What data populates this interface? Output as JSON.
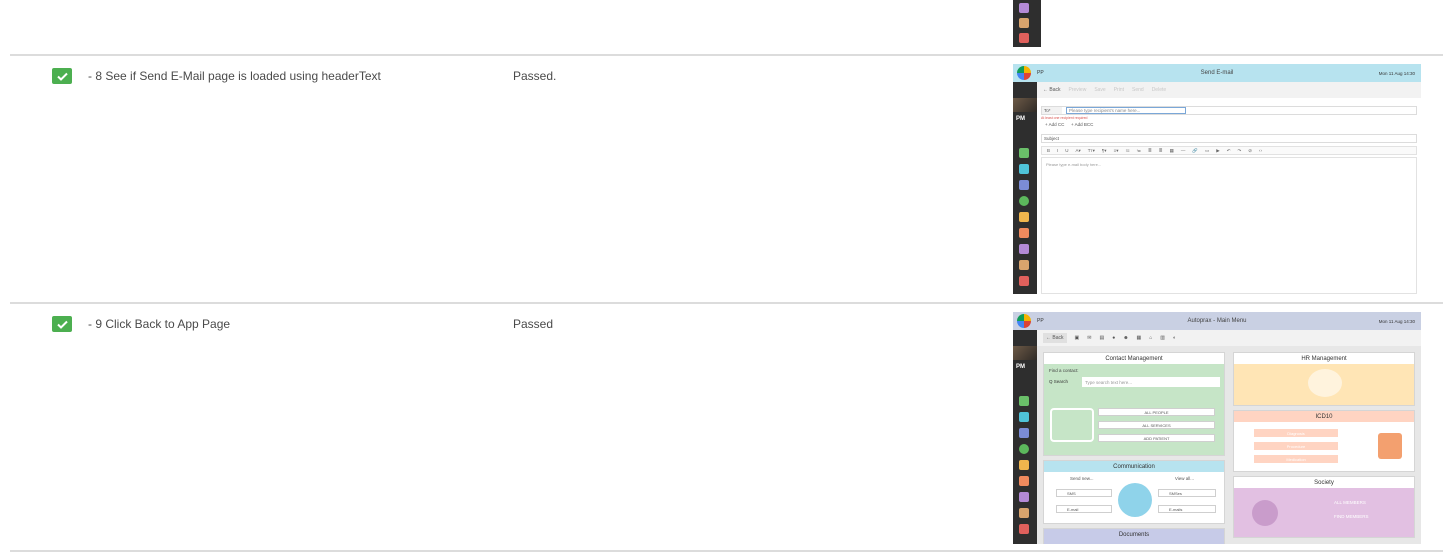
{
  "rows": [
    {
      "status": "passed",
      "step": "- 8 See if Send E-Mail page is loaded using headerText",
      "result": "Passed.",
      "screenshot": {
        "app_name": "PP",
        "page_title": "Send E-mail",
        "clock": "Mon 11 Aug 14:30",
        "toolbar": [
          "← Back",
          "Preview",
          "Save",
          "Print",
          "Send",
          "Delete"
        ],
        "to_label": "To*",
        "to_placeholder": "Please type recipient's name here...",
        "to_error": "At least one recipient required",
        "add_cc": "+ Add CC",
        "add_bcc": "+ Add BCC",
        "subject_label": "Subject",
        "editor_placeholder": "Please type e-mail body here...",
        "editor_toolbar": [
          "B",
          "I",
          "U",
          "A▾",
          "Tт▾",
          "¶▾",
          "≡▾",
          "⁝≡",
          "≔",
          "≣",
          "≣",
          "▦",
          "—",
          "🔗",
          "▭",
          "▶",
          "↶",
          "↷",
          "⊘",
          "‹›"
        ],
        "sidebar_initials": "PM"
      }
    },
    {
      "status": "passed",
      "step": "- 9 Click Back to App Page",
      "result": "Passed",
      "screenshot": {
        "app_name": "PP",
        "page_title": "Autoprax - Main Menu",
        "clock": "Mon 11 Aug 14:30",
        "back": "← Back",
        "contact_title": "Contact Management",
        "find_contact": "Find a contact:",
        "search_btn": "Q Search",
        "search_placeholder": "Type search text here...",
        "contact_buttons": [
          "ALL PEOPLE",
          "ALL SERVICES",
          "ADD PATIENT"
        ],
        "communication_title": "Communication",
        "send_new": "Send new...",
        "view_all": "View all...",
        "comm_left": [
          "SMS",
          "E-mail"
        ],
        "comm_right": [
          "SMSes",
          "E-mails"
        ],
        "documents_title": "Documents",
        "hr_title": "HR Management",
        "icd_title": "ICD10",
        "icd_buttons": [
          "Diagnosis",
          "Procedure",
          "Medication"
        ],
        "society_title": "Society",
        "society_buttons": [
          "ALL MEMBERS",
          "FIND MEMBERS"
        ],
        "sidebar_initials": "PM"
      }
    }
  ],
  "colors": {
    "check": "#4caf50",
    "sendmail_header": "#b7e3ef",
    "mainmenu_header": "#c9d0e3",
    "contact_green": "#c6e5c7",
    "comm_blue": "#b7e3ef",
    "hr_yellow": "#ffe5b5",
    "icd_orange": "#ffd4c2",
    "society_purple": "#e2c0e2",
    "docs_lavender": "#c7cbe8"
  }
}
